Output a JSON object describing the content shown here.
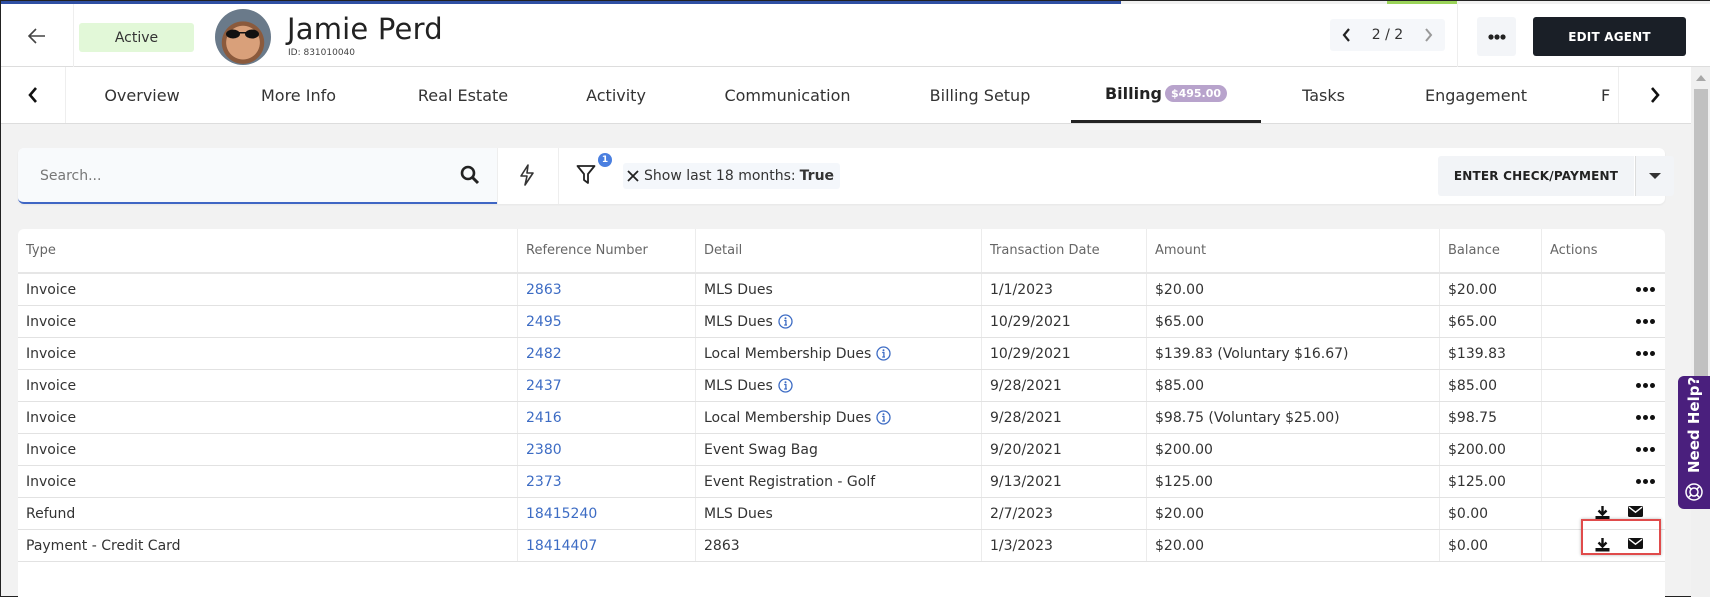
{
  "header": {
    "status": "Active",
    "agent_name": "Jamie Perd",
    "agent_id": "ID: 831010040",
    "pager": "2 / 2",
    "edit_button": "EDIT AGENT"
  },
  "tabs": [
    {
      "label": "Overview"
    },
    {
      "label": "More Info"
    },
    {
      "label": "Real Estate"
    },
    {
      "label": "Activity"
    },
    {
      "label": "Communication"
    },
    {
      "label": "Billing Setup"
    },
    {
      "label": "Billing",
      "badge": "$495.00",
      "active": true
    },
    {
      "label": "Tasks"
    },
    {
      "label": "Engagement"
    },
    {
      "label": "F"
    }
  ],
  "filterbar": {
    "search_placeholder": "Search...",
    "filter_count": "1",
    "chip_label": "Show last 18 months:",
    "chip_value": "True",
    "payment_button": "ENTER CHECK/PAYMENT"
  },
  "table": {
    "columns": [
      "Type",
      "Reference Number",
      "Detail",
      "Transaction Date",
      "Amount",
      "Balance",
      "Actions"
    ],
    "rows": [
      {
        "type": "Invoice",
        "ref": "2863",
        "detail": "MLS Dues",
        "info": false,
        "date": "1/1/2023",
        "amount": "$20.00",
        "balance": "$20.00",
        "actions": "more"
      },
      {
        "type": "Invoice",
        "ref": "2495",
        "detail": "MLS Dues",
        "info": true,
        "date": "10/29/2021",
        "amount": "$65.00",
        "balance": "$65.00",
        "actions": "more"
      },
      {
        "type": "Invoice",
        "ref": "2482",
        "detail": "Local Membership Dues",
        "info": true,
        "date": "10/29/2021",
        "amount": "$139.83 (Voluntary $16.67)",
        "balance": "$139.83",
        "actions": "more"
      },
      {
        "type": "Invoice",
        "ref": "2437",
        "detail": "MLS Dues",
        "info": true,
        "date": "9/28/2021",
        "amount": "$85.00",
        "balance": "$85.00",
        "actions": "more"
      },
      {
        "type": "Invoice",
        "ref": "2416",
        "detail": "Local Membership Dues",
        "info": true,
        "date": "9/28/2021",
        "amount": "$98.75 (Voluntary $25.00)",
        "balance": "$98.75",
        "actions": "more"
      },
      {
        "type": "Invoice",
        "ref": "2380",
        "detail": "Event Swag Bag",
        "info": false,
        "date": "9/20/2021",
        "amount": "$200.00",
        "balance": "$200.00",
        "actions": "more"
      },
      {
        "type": "Invoice",
        "ref": "2373",
        "detail": "Event Registration - Golf",
        "info": false,
        "date": "9/13/2021",
        "amount": "$125.00",
        "balance": "$125.00",
        "actions": "more"
      },
      {
        "type": "Refund",
        "ref": "18415240",
        "detail": "MLS Dues",
        "info": false,
        "date": "2/7/2023",
        "amount": "$20.00",
        "balance": "$0.00",
        "actions": "download-email"
      },
      {
        "type": "Payment - Credit Card",
        "ref": "18414407",
        "detail": "2863",
        "info": false,
        "date": "1/3/2023",
        "amount": "$20.00",
        "balance": "$0.00",
        "actions": "download-email"
      }
    ]
  },
  "help_tab": "Need Help?",
  "colors": {
    "accent_blue": "#3f66c4",
    "status_green_bg": "#e2f8d8",
    "billing_badge": "#b8a3cc",
    "help_purple": "#4a1f7d",
    "highlight_red": "#e04b4b",
    "edit_button_bg": "#1a1f27"
  }
}
